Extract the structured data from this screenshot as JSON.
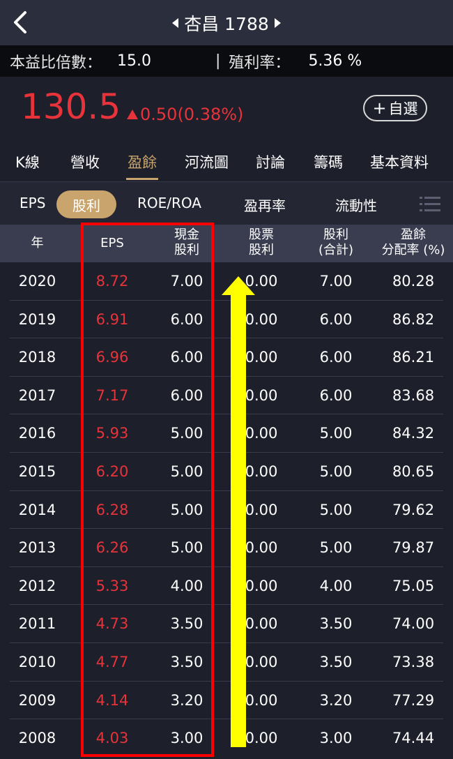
{
  "header": {
    "title": "杏昌 1788"
  },
  "ratios": {
    "pe_label": "本益比倍數：",
    "pe_value": "15.0",
    "separator": "|",
    "yield_label": "殖利率：",
    "yield_value": "5.36 %"
  },
  "quote": {
    "price": "130.5",
    "change": "0.50(0.38%)",
    "fav_label": "自選"
  },
  "tabs": [
    "K線",
    "營收",
    "盈餘",
    "河流圖",
    "討論",
    "籌碼",
    "基本資料"
  ],
  "subtabs": [
    "EPS",
    "股利",
    "ROE/ROA",
    "盈再率",
    "流動性"
  ],
  "table": {
    "headers": {
      "year": "年",
      "eps": "EPS",
      "cash1": "現金",
      "cash2": "股利",
      "stock1": "股票",
      "stock2": "股利",
      "total1": "股利",
      "total2": "(合計)",
      "payout1": "盈餘",
      "payout2": "分配率 (%)"
    },
    "rows": [
      [
        "2020",
        "8.72",
        "7.00",
        "0.00",
        "7.00",
        "80.28"
      ],
      [
        "2019",
        "6.91",
        "6.00",
        "0.00",
        "6.00",
        "86.82"
      ],
      [
        "2018",
        "6.96",
        "6.00",
        "0.00",
        "6.00",
        "86.21"
      ],
      [
        "2017",
        "7.17",
        "6.00",
        "0.00",
        "6.00",
        "83.68"
      ],
      [
        "2016",
        "5.93",
        "5.00",
        "0.00",
        "5.00",
        "84.32"
      ],
      [
        "2015",
        "6.20",
        "5.00",
        "0.00",
        "5.00",
        "80.65"
      ],
      [
        "2014",
        "6.28",
        "5.00",
        "0.00",
        "5.00",
        "79.62"
      ],
      [
        "2013",
        "6.26",
        "5.00",
        "0.00",
        "5.00",
        "79.87"
      ],
      [
        "2012",
        "5.33",
        "4.00",
        "0.00",
        "4.00",
        "75.05"
      ],
      [
        "2011",
        "4.73",
        "3.50",
        "0.00",
        "3.50",
        "74.00"
      ],
      [
        "2010",
        "4.77",
        "3.50",
        "0.00",
        "3.50",
        "73.38"
      ],
      [
        "2009",
        "4.14",
        "3.20",
        "0.00",
        "3.20",
        "77.29"
      ],
      [
        "2008",
        "4.03",
        "3.00",
        "0.00",
        "3.00",
        "74.44"
      ]
    ]
  },
  "colors": {
    "up": "#e8333a",
    "accent": "#c9a46c",
    "highlight": "#ff0000",
    "arrow": "#ffff00"
  }
}
